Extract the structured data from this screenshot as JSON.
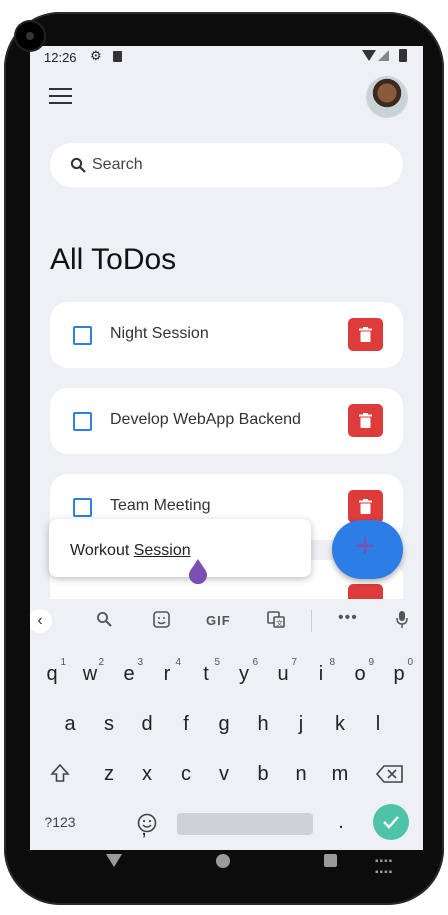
{
  "status_bar": {
    "time": "12:26"
  },
  "search": {
    "placeholder": "Search"
  },
  "page": {
    "title": "All ToDos"
  },
  "todos": [
    {
      "label": "Night Session"
    },
    {
      "label": "Develop WebApp Backend"
    },
    {
      "label": "Team Meeting"
    }
  ],
  "input_popup": {
    "text_prefix": "Workout ",
    "text_word": "Session"
  },
  "fab": {
    "label": "+"
  },
  "keyboard": {
    "toolbar": {
      "gif": "GIF"
    },
    "row1": [
      {
        "key": "q",
        "num": "1"
      },
      {
        "key": "w",
        "num": "2"
      },
      {
        "key": "e",
        "num": "3"
      },
      {
        "key": "r",
        "num": "4"
      },
      {
        "key": "t",
        "num": "5"
      },
      {
        "key": "y",
        "num": "6"
      },
      {
        "key": "u",
        "num": "7"
      },
      {
        "key": "i",
        "num": "8"
      },
      {
        "key": "o",
        "num": "9"
      },
      {
        "key": "p",
        "num": "0"
      }
    ],
    "row2": [
      "a",
      "s",
      "d",
      "f",
      "g",
      "h",
      "j",
      "k",
      "l"
    ],
    "row3": [
      "z",
      "x",
      "c",
      "v",
      "b",
      "n",
      "m"
    ],
    "symbols_key": "?123",
    "comma": ",",
    "period": "."
  },
  "icons": {
    "menu": "hamburger-menu-icon",
    "search": "search-icon",
    "delete": "trash-icon",
    "checkbox": "checkbox-outline-icon"
  },
  "colors": {
    "accent": "#2c7ee6",
    "delete": "#de3b3b",
    "enter": "#4fc3a8",
    "background": "#eef0f5"
  }
}
